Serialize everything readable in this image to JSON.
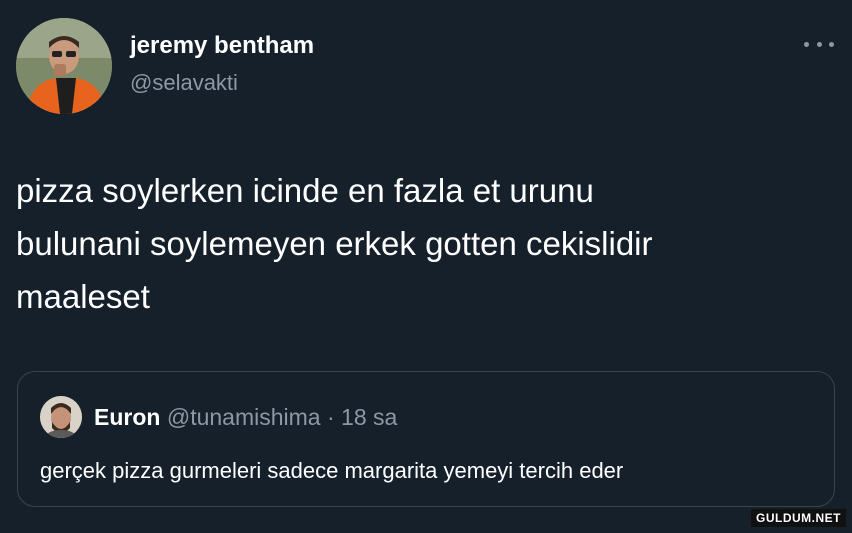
{
  "tweet": {
    "author_name": "jeremy bentham",
    "author_handle": "@selavakti",
    "text": "pizza soylerken icinde en fazla et urunu\nbulunani soylemeyen erkek gotten cekislidir\nmaaleset"
  },
  "quoted_tweet": {
    "author_name": "Euron",
    "author_handle": "@tunamishima",
    "separator": "·",
    "time": "18 sa",
    "text": "gerçek pizza gurmeleri sadece margarita yemeyi tercih eder"
  },
  "watermark": "GULDUM.NET",
  "icons": {
    "more": "more-horizontal-icon"
  },
  "colors": {
    "background": "#15202b",
    "secondary_text": "#8b98a5",
    "border": "#38444d"
  }
}
